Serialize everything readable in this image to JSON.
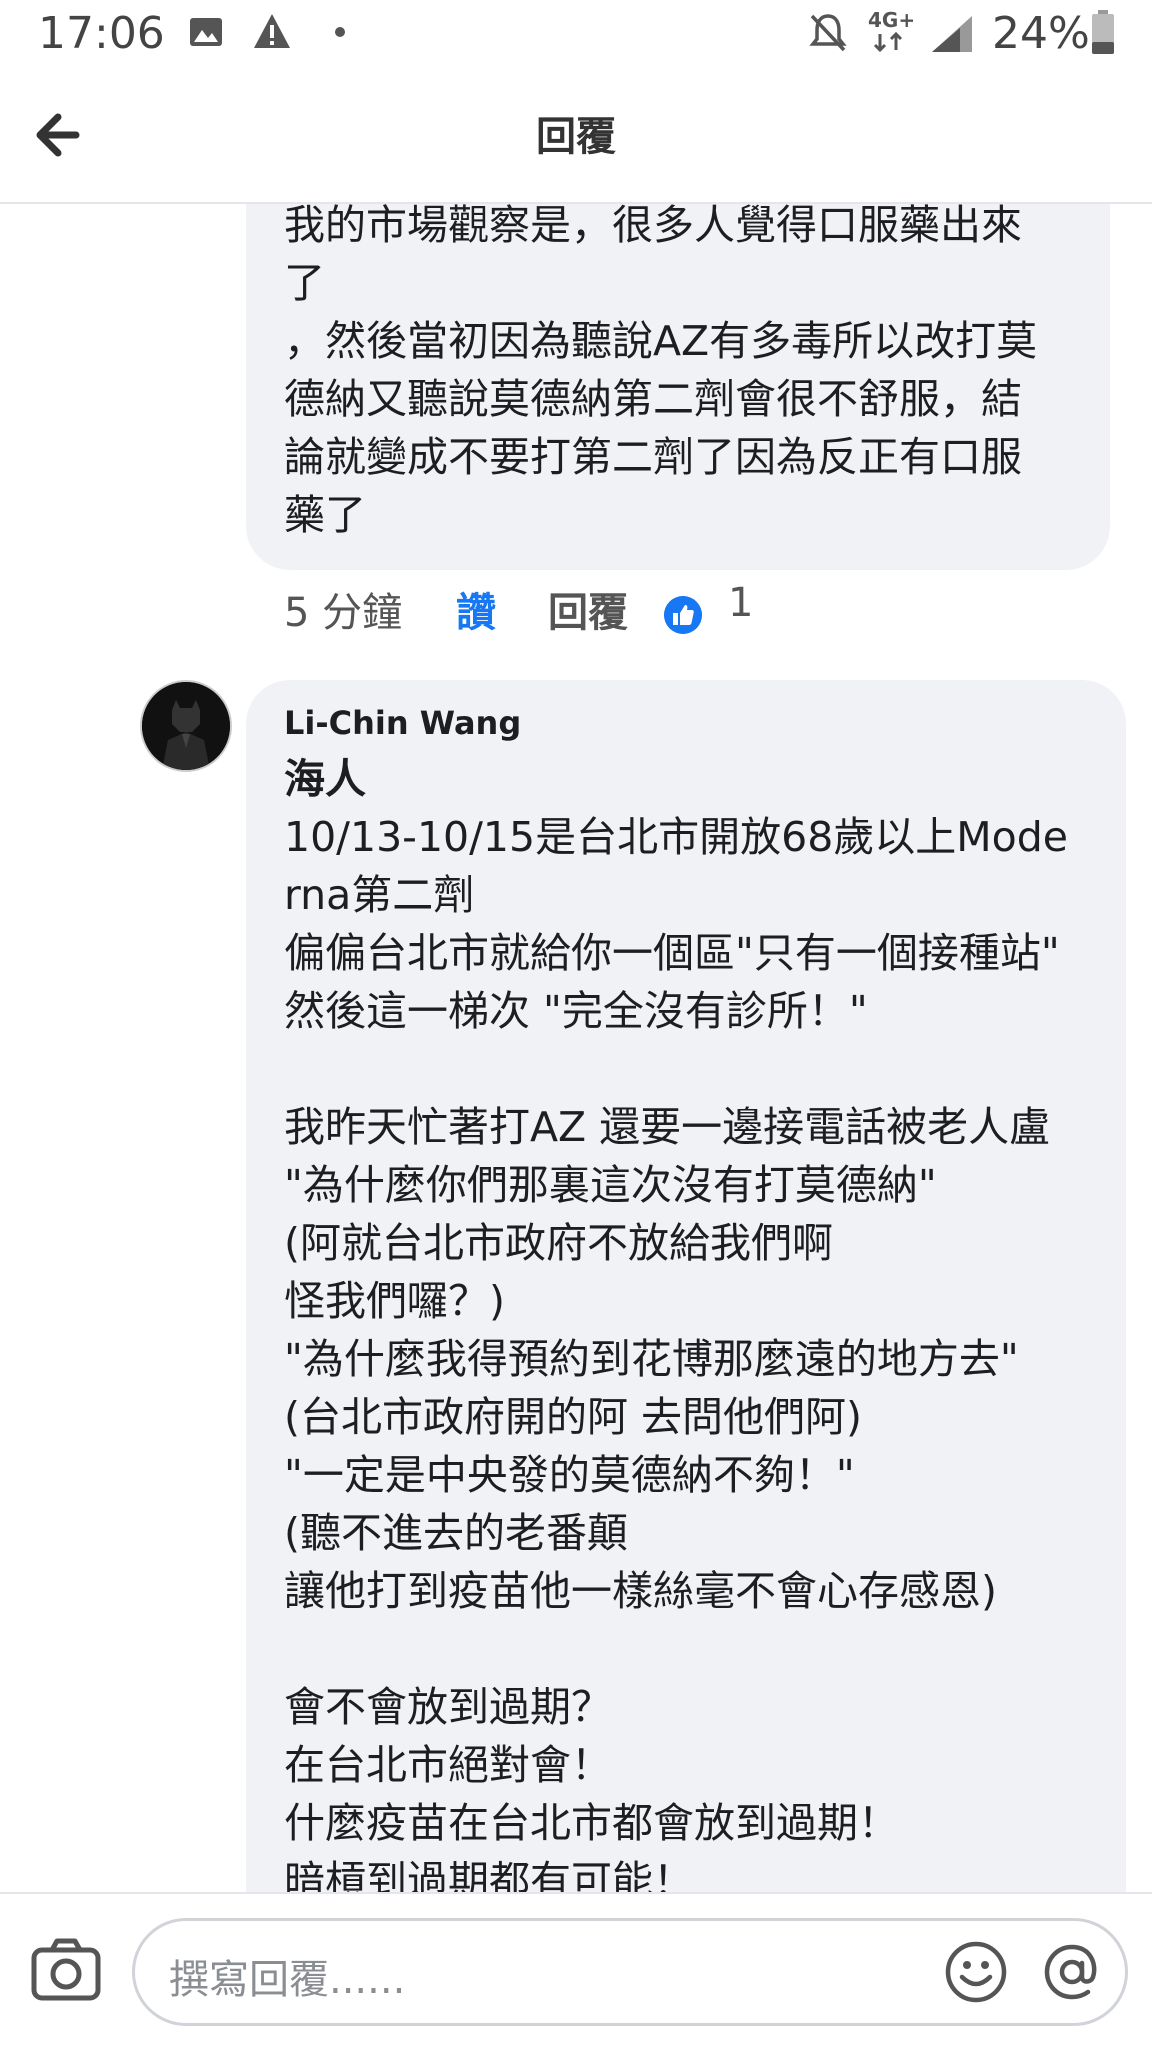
{
  "status_bar": {
    "time": "17:06",
    "network": "4G+",
    "battery": "24%"
  },
  "header": {
    "title": "回覆"
  },
  "comments": [
    {
      "text": "我的市場觀察是，很多人覺得口服藥出來\n了\n，然後當初因為聽說AZ有多毒所以改打莫\n德納又聽說莫德納第二劑會很不舒服，結\n論就變成不要打第二劑了因為反正有口服\n藥了",
      "time": "5 分鐘",
      "like_label": "讚",
      "reply_label": "回覆",
      "reaction_count": "1"
    },
    {
      "author": "Li-Chin Wang",
      "lead": "海人",
      "body": "10/13-10/15是台北市開放68歲以上Mode\nrna第二劑\n偏偏台北市就給你一個區\"只有一個接種站\"\n然後這一梯次 \"完全沒有診所！\"\n\n我昨天忙著打AZ 還要一邊接電話被老人盧\n\"為什麼你們那裏這次沒有打莫德納\"\n(阿就台北市政府不放給我們啊\n怪我們囉？)\n\"為什麼我得預約到花博那麼遠的地方去\"\n(台北市政府開的阿 去問他們阿)\n\"一定是中央發的莫德納不夠！\"\n(聽不進去的老番顛\n讓他打到疫苗他一樣絲毫不會心存感恩)\n\n會不會放到過期？\n在台北市絕對會！\n什麼疫苗在台北市都會放到過期！\n暗槓到過期都有可能！"
    }
  ],
  "composer": {
    "placeholder": "撰寫回覆......"
  },
  "icons": {
    "back": "arrow-left-icon",
    "camera": "camera-icon",
    "emoji": "emoji-icon",
    "mention": "at-sign-icon",
    "like_badge": "thumbs-up-icon"
  },
  "colors": {
    "accent": "#1877f2",
    "bubble": "#f0f2f5"
  }
}
